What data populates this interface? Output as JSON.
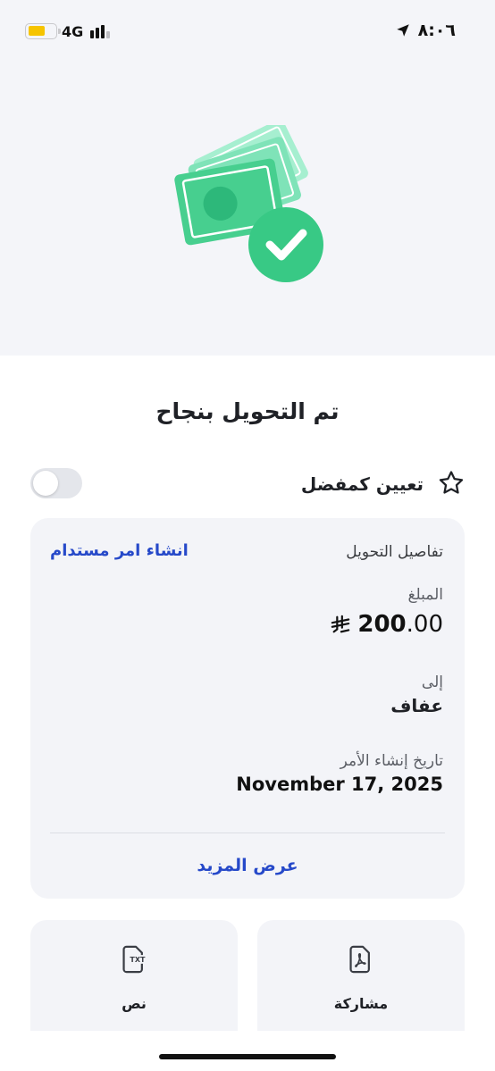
{
  "status_bar": {
    "time": "٨:٠٦",
    "network": "4G",
    "battery_color": "#f6c400",
    "location_icon": "location-arrow-icon"
  },
  "hero": {
    "illustration": "money-success-icon",
    "accent_color": "#3fd28f"
  },
  "title": "تم التحويل بنجاح",
  "favorite": {
    "label": "تعيين كمفضل",
    "icon": "star-icon",
    "enabled": false
  },
  "details": {
    "section_title": "تفاصيل التحويل",
    "create_order_link": "انشاء امر مستدام",
    "amount_label": "المبلغ",
    "amount_int": "200",
    "amount_dec": ".00",
    "currency_icon": "riyal-icon",
    "to_label": "إلى",
    "recipient": "عفاف",
    "date_label": "تاريخ إنشاء الأمر",
    "date_value": "November 17, 2025",
    "show_more": "عرض المزيد"
  },
  "actions": [
    {
      "label": "مشاركة",
      "icon": "pdf-share-icon"
    },
    {
      "label": "نص",
      "icon": "txt-file-icon"
    }
  ],
  "colors": {
    "link_blue": "#2649c9",
    "card_bg": "#f3f4f8",
    "hero_bg": "#f4f5f9"
  }
}
